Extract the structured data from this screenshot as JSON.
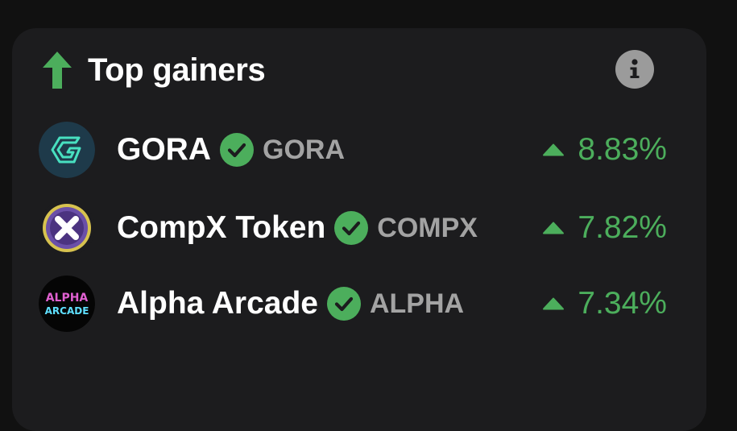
{
  "colors": {
    "background": "#111111",
    "card": "#1c1c1e",
    "accent_green": "#4cae5c",
    "ticker_gray": "#a3a3a3",
    "info_gray": "#9b9b9b"
  },
  "widget": {
    "title": "Top gainers",
    "title_icon": "arrow-up-icon",
    "info_icon": "info-icon"
  },
  "tokens": [
    {
      "name": "GORA",
      "ticker": "GORA",
      "verified": true,
      "change": "8.83%",
      "direction": "up",
      "logo": "gora-logo"
    },
    {
      "name": "CompX Token",
      "ticker": "COMPX",
      "verified": true,
      "change": "7.82%",
      "direction": "up",
      "logo": "compx-logo"
    },
    {
      "name": "Alpha Arcade",
      "ticker": "ALPHA",
      "verified": true,
      "change": "7.34%",
      "direction": "up",
      "logo": "alpha-arcade-logo",
      "logo_text": [
        "ALPHA",
        "ARCADE"
      ]
    }
  ]
}
